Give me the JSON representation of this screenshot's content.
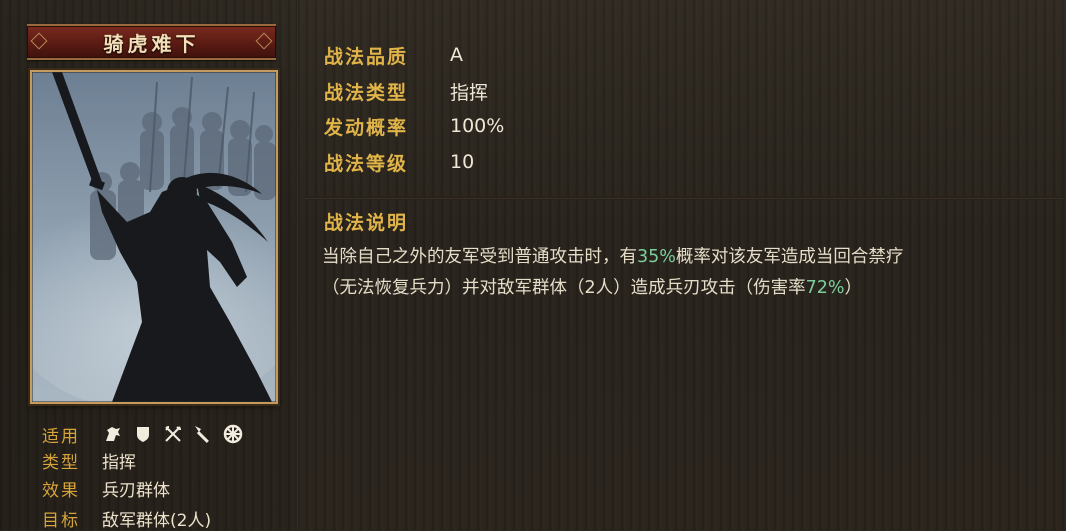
{
  "skill": {
    "name": "骑虎难下"
  },
  "stats": [
    {
      "label": "战法品质",
      "value": "A"
    },
    {
      "label": "战法类型",
      "value": "指挥"
    },
    {
      "label": "发动概率",
      "value": "100%"
    },
    {
      "label": "战法等级",
      "value": "10"
    }
  ],
  "info": {
    "applicable_label": "适用",
    "applicable_icons": [
      "cavalry-icon",
      "shield-icon",
      "crossed-bows-icon",
      "spear-icon",
      "wheel-icon"
    ],
    "type_label": "类型",
    "type_value": "指挥",
    "effect_label": "效果",
    "effect_value": "兵刃群体",
    "target_label": "目标",
    "target_value": "敌军群体(2人)"
  },
  "description": {
    "title": "战法说明",
    "line1_a": "当除自己之外的友军受到普通攻击时，有",
    "line1_pct": "35%",
    "line1_b": "概率对该友军造成当回合禁疗",
    "line2_a": "（无法恢复兵力）并对敌军群体（2人）造成兵刃攻击（伤害率",
    "line2_pct": "72%",
    "line2_b": "）"
  },
  "colors": {
    "gold_label": "#e0b448",
    "text": "#ece2cc",
    "highlight": "#7ccf9c",
    "plate_red": "#5a1b13"
  }
}
